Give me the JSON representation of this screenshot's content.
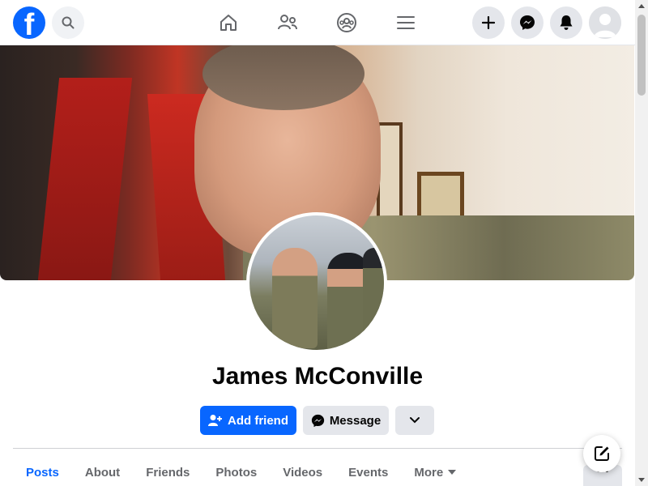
{
  "header": {
    "logo_letter": "f",
    "nav": [
      {
        "name": "home",
        "icon": "home-icon"
      },
      {
        "name": "friends",
        "icon": "friends-icon"
      },
      {
        "name": "groups",
        "icon": "groups-icon"
      },
      {
        "name": "menu",
        "icon": "hamburger-icon"
      }
    ],
    "actions": [
      "plus-icon",
      "messenger-icon",
      "bell-icon",
      "avatar"
    ]
  },
  "profile": {
    "name": "James McConville",
    "add_friend_label": "Add friend",
    "message_label": "Message"
  },
  "tabs": [
    {
      "label": "Posts",
      "active": true
    },
    {
      "label": "About",
      "active": false
    },
    {
      "label": "Friends",
      "active": false
    },
    {
      "label": "Photos",
      "active": false
    },
    {
      "label": "Videos",
      "active": false
    },
    {
      "label": "Events",
      "active": false
    },
    {
      "label": "More",
      "active": false
    }
  ],
  "colors": {
    "brand": "#0866ff",
    "button_gray": "#e4e6eb",
    "text_primary": "#050505",
    "text_secondary": "#65676b"
  }
}
